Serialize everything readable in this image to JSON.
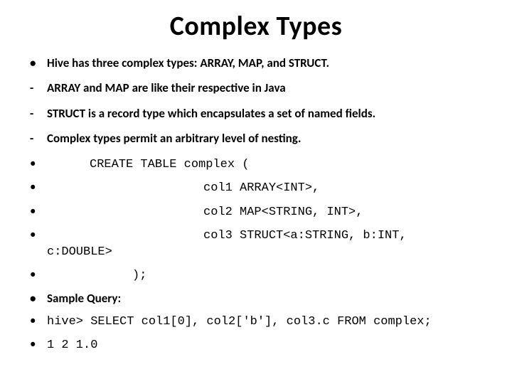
{
  "title": "Complex Types",
  "items": [
    {
      "marker": "disc",
      "bold": true,
      "mono": false,
      "text": "Hive has three complex types: ARRAY, MAP, and STRUCT."
    },
    {
      "marker": "dash",
      "bold": true,
      "mono": false,
      "text": "ARRAY and MAP are like their respective in Java"
    },
    {
      "marker": "dash",
      "bold": true,
      "mono": false,
      "text": "STRUCT is a record type which encapsulates a set of named fields."
    },
    {
      "marker": "dash",
      "bold": true,
      "mono": false,
      "text": "Complex types permit an arbitrary level of nesting."
    }
  ],
  "code": {
    "l1": "CREATE TABLE complex (",
    "l2": "col1 ARRAY<INT>,",
    "l3": "col2 MAP<STRING, INT>,",
    "l4a": "col3 STRUCT<a:STRING, b:INT,",
    "l4b": "c:DOUBLE>",
    "l5": ");"
  },
  "sample_label": "Sample Query:",
  "query": "hive> SELECT col1[0], col2['b'], col3.c FROM complex;",
  "result": "1 2 1.0"
}
